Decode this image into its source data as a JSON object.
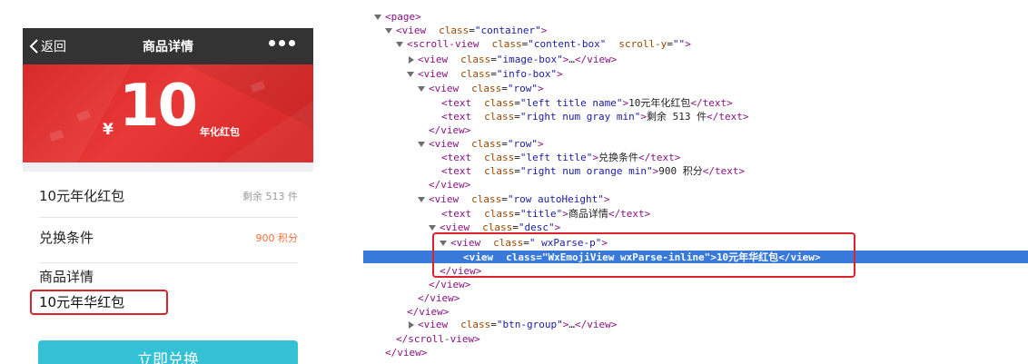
{
  "preview": {
    "navbar": {
      "back_label": "返回",
      "title": "商品详情"
    },
    "banner": {
      "currency": "¥",
      "amount": "10",
      "unit": "年化红包"
    },
    "rows": [
      {
        "left": "10元年化红包",
        "right": "剩余 513 件"
      },
      {
        "left": "兑换条件",
        "right": "900 积分"
      }
    ],
    "desc_title": "商品详情",
    "desc_text": "10元年华红包",
    "button_label": "立即兑换"
  },
  "tree": {
    "page": "page",
    "view": "view",
    "scroll_view": "scroll-view",
    "text": "text",
    "class": "class",
    "scroll_y": "scroll-y",
    "empty": "\"\"",
    "container": "\"container\"",
    "content_box": "\"content-box\"",
    "image_box": "\"image-box\"",
    "info_box": "\"info-box\"",
    "row": "\"row\"",
    "left_title_name": "\"left title name\"",
    "right_num_gray_min": "\"right num gray min\"",
    "left_title": "\"left title\"",
    "right_num_orange_min": "\"right num orange min\"",
    "row_autoheight": "\"row autoHeight\"",
    "title": "\"title\"",
    "desc": "\"desc\"",
    "wxparse_p": "\" wxParse-p\"",
    "wxemoji": "\"WxEmojiView wxParse-inline\"",
    "btn_group": "\"btn-group\"",
    "t1": "10元年化红包",
    "t2": "剩余 513 件",
    "t3": "兑换条件",
    "t4": "900 积分",
    "t5": "商品详情",
    "t6": "10元年华红包",
    "ellipsis": "…"
  }
}
